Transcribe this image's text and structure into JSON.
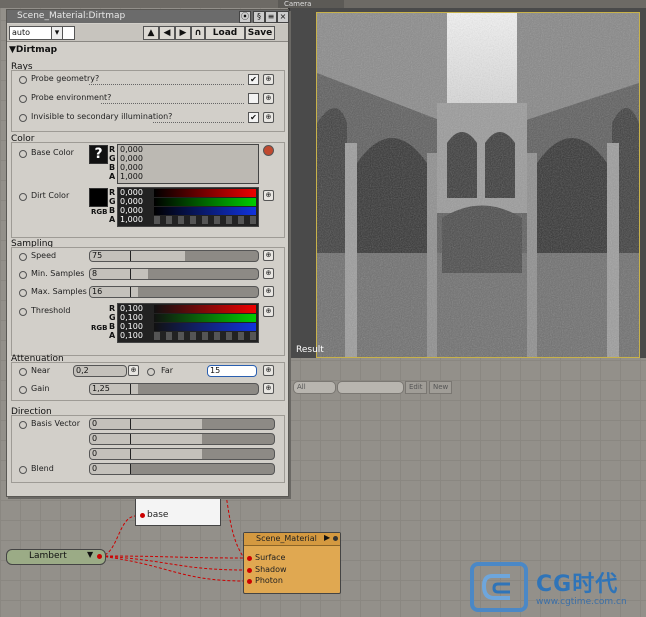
{
  "viewport": {
    "tab": "Camera",
    "render_label": "Result"
  },
  "panel": {
    "title": "Scene_Material:Dirtmap",
    "preset": "auto",
    "load_label": "Load",
    "save_label": "Save",
    "node_name": "Dirtmap",
    "rays": {
      "head": "Rays",
      "items": [
        {
          "label": "Probe geometry?",
          "checked": true
        },
        {
          "label": "Probe environment?",
          "checked": false
        },
        {
          "label": "Invisible to secondary illumination?",
          "checked": true
        }
      ]
    },
    "color": {
      "head": "Color",
      "base_label": "Base Color",
      "dirt_label": "Dirt Color",
      "base_values": {
        "R": "0,000",
        "G": "0,000",
        "B": "0,000",
        "A": "1,000"
      },
      "dirt_values": {
        "R": "0,000",
        "G": "0,000",
        "B": "0,000",
        "A": "1,000"
      },
      "rgb_tag": "RGB"
    },
    "sampling": {
      "head": "Sampling",
      "speed_label": "Speed",
      "speed_value": "75",
      "min_label": "Min. Samples",
      "min_value": "8",
      "max_label": "Max. Samples",
      "max_value": "16",
      "threshold_label": "Threshold",
      "threshold_values": {
        "R": "0,100",
        "G": "0,100",
        "B": "0,100",
        "A": "0,100"
      }
    },
    "attenuation": {
      "head": "Attenuation",
      "near_label": "Near",
      "near_value": "0,2",
      "far_label": "Far",
      "far_value": "15",
      "gain_label": "Gain",
      "gain_value": "1,25"
    },
    "direction": {
      "head": "Direction",
      "basis_label": "Basis Vector",
      "basis_values": [
        "0",
        "0",
        "0"
      ],
      "blend_label": "Blend",
      "blend_value": "0"
    }
  },
  "node_toolbar": {
    "filter": "All",
    "edit": "Edit",
    "new": "New"
  },
  "nodes": {
    "lambert": "Lambert",
    "dirtmap_port": "base",
    "scene_material": "Scene_Material",
    "ports": [
      "Surface",
      "Shadow",
      "Photon"
    ]
  },
  "watermark": {
    "brand": "CG时代",
    "url": "www.cgtime.com.cn"
  },
  "colors": {
    "panel": "#d2cfc9",
    "node_material": "#e0a851",
    "node_lambert": "#9bab86",
    "connection": "#cc0000",
    "accent_blue": "#2f74b8"
  }
}
